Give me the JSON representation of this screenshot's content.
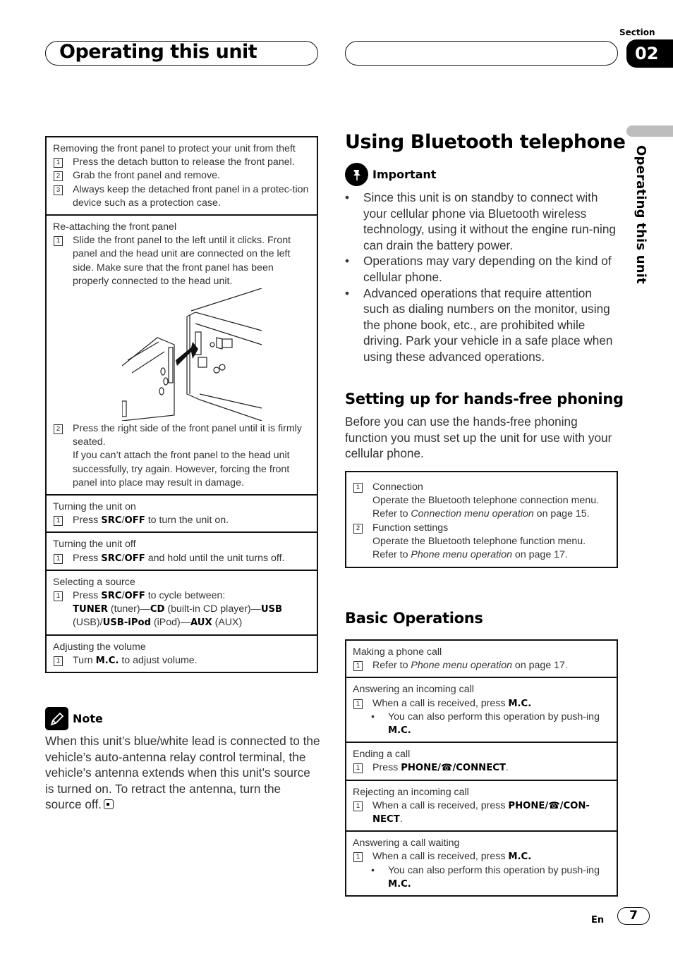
{
  "header": {
    "title": "Operating this unit",
    "section_label": "Section",
    "section_number": "02"
  },
  "side_tab": {
    "label": "Operating this unit"
  },
  "left_box": {
    "removing": {
      "title": "Removing the front panel to protect your unit from theft",
      "steps": [
        {
          "n": "1",
          "text": "Press the detach button to release the front panel."
        },
        {
          "n": "2",
          "text": "Grab the front panel and remove."
        },
        {
          "n": "3",
          "text": "Always keep the detached front panel in a protec-tion device such as a protection case."
        }
      ]
    },
    "reattaching": {
      "title": "Re-attaching the front panel",
      "step1_n": "1",
      "step1_text": "Slide the front panel to the left until it clicks. Front panel and the head unit are connected on the left side. Make sure that the front panel has been properly connected to the head unit.",
      "illustration": "front-panel-attach-illustration",
      "step2_n": "2",
      "step2_text": "Press the right side of the front panel until it is firmly seated.",
      "step2_note": "If you can’t attach the front panel to the head unit successfully, try again. However, forcing the front panel into place may result in damage."
    },
    "turning_on": {
      "title": "Turning the unit on",
      "n": "1",
      "pre": "Press ",
      "key": "SRC",
      "sep": "/",
      "key2": "OFF",
      "post": " to turn the unit on."
    },
    "turning_off": {
      "title": "Turning the unit off",
      "n": "1",
      "pre": "Press ",
      "key": "SRC",
      "sep": "/",
      "key2": "OFF",
      "post": " and hold until the unit turns off."
    },
    "selecting_source": {
      "title": "Selecting a source",
      "n": "1",
      "pre": "Press ",
      "key": "SRC",
      "sep": "/",
      "key2": "OFF",
      "post": " to cycle between:",
      "sources": [
        {
          "name": "TUNER",
          "desc": " (tuner)—"
        },
        {
          "name": "CD",
          "desc": " (built-in CD player)—"
        },
        {
          "name": "USB",
          "desc": " (USB)/"
        },
        {
          "name": "USB-iPod",
          "desc": " (iPod)—"
        },
        {
          "name": "AUX",
          "desc": " (AUX)"
        }
      ]
    },
    "volume": {
      "title": "Adjusting the volume",
      "n": "1",
      "pre": "Turn ",
      "key": "M.C.",
      "post": " to adjust volume."
    }
  },
  "note": {
    "label": "Note",
    "icon": "pencil-icon",
    "text": "When this unit’s blue/white lead is connected to the vehicle’s auto-antenna relay control terminal, the vehicle’s antenna extends when this unit’s source is turned on. To retract the antenna, turn the source off."
  },
  "bluetooth": {
    "title": "Using Bluetooth telephone",
    "important_label": "Important",
    "important_icon": "pushpin-icon",
    "bullets": [
      "Since this unit is on standby to connect with your cellular phone via Bluetooth wireless technology, using it without the engine run-ning can drain the battery power.",
      "Operations may vary depending on the kind of cellular phone.",
      "Advanced operations that require attention such as dialing numbers on the monitor, using the phone book, etc., are prohibited while driving. Park your vehicle in a safe place when using these advanced operations."
    ]
  },
  "handsfree": {
    "title": "Setting up for hands-free phoning",
    "intro": "Before you can use the hands-free phoning function you must set up the unit for use with your cellular phone.",
    "steps": [
      {
        "n": "1",
        "title": "Connection",
        "pre": "Operate the Bluetooth telephone connection menu. Refer to ",
        "ref": "Connection menu operation",
        "post": " on page 15."
      },
      {
        "n": "2",
        "title": "Function settings",
        "pre": "Operate the Bluetooth telephone function menu. Refer to ",
        "ref": "Phone menu operation",
        "post": " on page 17."
      }
    ]
  },
  "basic_ops": {
    "title": "Basic Operations",
    "making": {
      "title": "Making a phone call",
      "n": "1",
      "pre": "Refer to ",
      "ref": "Phone menu operation",
      "post": " on page 17."
    },
    "answering": {
      "title": "Answering an incoming call",
      "n": "1",
      "pre": "When a call is received, press ",
      "key": "M.C.",
      "sub_pre": "You can also perform this operation by push-ing ",
      "sub_key": "M.C."
    },
    "ending": {
      "title": "Ending a call",
      "n": "1",
      "pre": "Press ",
      "key": "PHONE/",
      "key_icon": "telephone-icon",
      "key2": "/CONNECT",
      "post": "."
    },
    "rejecting": {
      "title": "Rejecting an incoming call",
      "n": "1",
      "pre": "When a call is received, press ",
      "key": "PHONE/",
      "key_icon": "telephone-icon",
      "key2": "/CON-NECT",
      "post": "."
    },
    "waiting": {
      "title": "Answering a call waiting",
      "n": "1",
      "pre": "When a call is received, press ",
      "key": "M.C.",
      "sub_pre": "You can also perform this operation by push-ing ",
      "sub_key": "M.C."
    }
  },
  "footer": {
    "lang": "En",
    "page": "7"
  }
}
